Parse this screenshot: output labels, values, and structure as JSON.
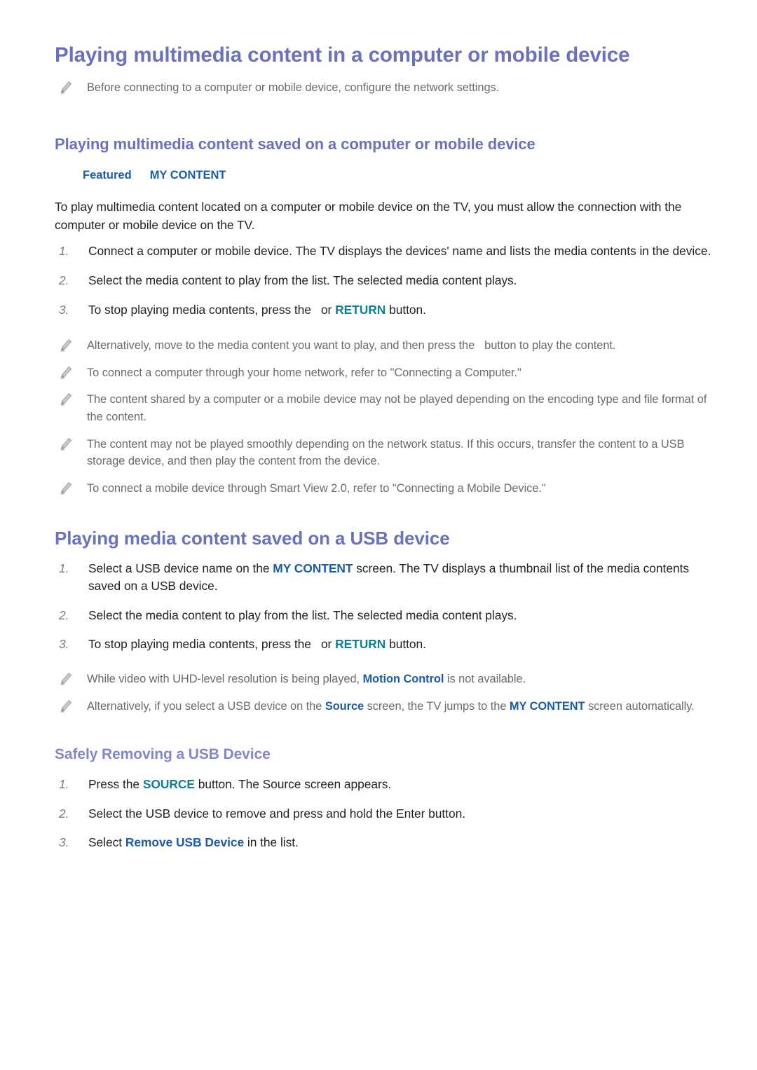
{
  "colors": {
    "heading_primary": "#6a72bf",
    "heading_secondary": "#8287c9",
    "accent_blue": "#1a5ca8",
    "accent_teal": "#0e7e96",
    "body_text": "#232323",
    "note_text": "#6b6b6b",
    "list_number": "#7a7a7a"
  },
  "section1": {
    "title": "Playing multimedia content in a computer or mobile device",
    "intro_note": "Before connecting to a computer or mobile device, configure the network settings.",
    "subtitle": "Playing multimedia content saved on a computer or mobile device",
    "breadcrumb": {
      "item1": "Featured",
      "item2": "MY CONTENT"
    },
    "paragraph": "To play multimedia content located on a computer or mobile device on the TV, you must allow the connection with the computer or mobile device on the TV.",
    "steps": [
      {
        "num": "1.",
        "text": "Connect a computer or mobile device. The TV displays the devices' name and lists the media contents in the device."
      },
      {
        "num": "2.",
        "text": "Select the media content to play from the list. The selected media content plays."
      },
      {
        "num": "3.",
        "pre": "To stop playing media contents, press the",
        "key": "RETURN",
        "mid": "or",
        "post": "button."
      }
    ],
    "notes": [
      {
        "pre": "Alternatively, move to the media content you want to play, and then press the",
        "post": "button to play the content."
      },
      {
        "text": "To connect a computer through your home network, refer to \"Connecting a Computer.\""
      },
      {
        "text": "The content shared by a computer or a mobile device may not be played depending on the encoding type and file format of the content."
      },
      {
        "text": "The content may not be played smoothly depending on the network status. If this occurs, transfer the content to a USB storage device, and then play the content from the device."
      },
      {
        "text": "To connect a mobile device through Smart View 2.0, refer to \"Connecting a Mobile Device.\""
      }
    ]
  },
  "section2": {
    "title": "Playing media content saved on a USB device",
    "steps": [
      {
        "num": "1.",
        "pre": "Select a USB device name on the",
        "key": "MY CONTENT",
        "post": "screen. The TV displays a thumbnail list of the media contents saved on a USB device."
      },
      {
        "num": "2.",
        "text": "Select the media content to play from the list. The selected media content plays."
      },
      {
        "num": "3.",
        "pre": "To stop playing media contents, press the",
        "key": "RETURN",
        "mid": "or",
        "post": "button."
      }
    ],
    "notes": [
      {
        "pre": "While video with UHD-level resolution is being played,",
        "key": "Motion Control",
        "post": "is not available."
      },
      {
        "pre": "Alternatively, if you select a USB device on the",
        "key1": "Source",
        "mid": "screen, the TV jumps to the",
        "key2": "MY CONTENT",
        "post": "screen automatically."
      }
    ]
  },
  "section3": {
    "title": "Safely Removing a USB Device",
    "steps": [
      {
        "num": "1.",
        "pre": "Press the",
        "key": "SOURCE",
        "post": "button. The Source screen appears."
      },
      {
        "num": "2.",
        "text": "Select the USB device to remove and press and hold the Enter button."
      },
      {
        "num": "3.",
        "pre": "Select",
        "key": "Remove USB Device",
        "post": "in the list."
      }
    ]
  },
  "icons": {
    "note": "pencil-icon"
  }
}
